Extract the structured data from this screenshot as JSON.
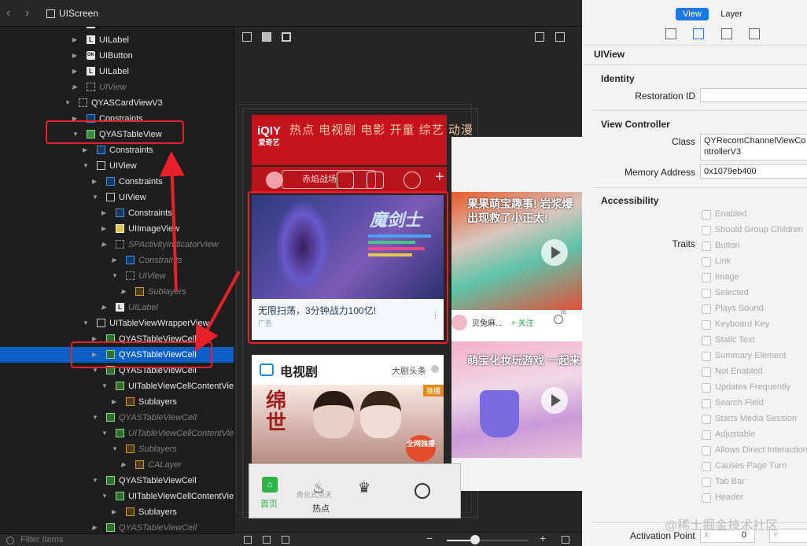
{
  "breadcrumb": {
    "title": "UIScreen"
  },
  "tree": [
    {
      "label": "UIButton",
      "icon": "",
      "dim": true
    },
    {
      "label": "UILabel",
      "icon": "L"
    },
    {
      "label": "UIButton",
      "icon": "OK"
    },
    {
      "label": "UILabel",
      "icon": "L"
    },
    {
      "label": "UIView",
      "icon": "",
      "dim": true
    },
    {
      "label": "QYASCardViewV3",
      "icon": ""
    },
    {
      "label": "Constraints",
      "icon": ""
    },
    {
      "label": "QYASTableView",
      "icon": ""
    },
    {
      "label": "Constraints",
      "icon": ""
    },
    {
      "label": "UIView",
      "icon": ""
    },
    {
      "label": "Constraints",
      "icon": ""
    },
    {
      "label": "UIView",
      "icon": ""
    },
    {
      "label": "Constraints",
      "icon": ""
    },
    {
      "label": "UIImageView",
      "icon": ""
    },
    {
      "label": "SPActivityIndicatorView",
      "icon": "",
      "dim": true
    },
    {
      "label": "Constraints",
      "icon": "",
      "dim": true
    },
    {
      "label": "UIView",
      "icon": "",
      "dim": true
    },
    {
      "label": "Sublayers",
      "icon": "",
      "dim": true
    },
    {
      "label": "UILabel",
      "icon": "L",
      "dim": true
    },
    {
      "label": "UITableViewWrapperView",
      "icon": ""
    },
    {
      "label": "QYASTableViewCell",
      "icon": ""
    },
    {
      "label": "QYASTableViewCell",
      "icon": ""
    },
    {
      "label": "QYASTableViewCell",
      "icon": ""
    },
    {
      "label": "UITableViewCellContentView",
      "icon": ""
    },
    {
      "label": "Sublayers",
      "icon": ""
    },
    {
      "label": "QYASTableViewCell",
      "icon": "",
      "dim": true
    },
    {
      "label": "UITableViewCellContentView",
      "icon": "",
      "dim": true
    },
    {
      "label": "Sublayers",
      "icon": "",
      "dim": true
    },
    {
      "label": "CALayer",
      "icon": "",
      "dim": true
    },
    {
      "label": "QYASTableViewCell",
      "icon": ""
    },
    {
      "label": "UITableViewCellContentView",
      "icon": ""
    },
    {
      "label": "Sublayers",
      "icon": ""
    },
    {
      "label": "QYASTableViewCell",
      "icon": "",
      "dim": true
    }
  ],
  "filter": {
    "placeholder": "Filter Items"
  },
  "app": {
    "logo": "爱奇艺",
    "tabs": "热点  电视剧  电影  开童  综艺  动漫",
    "search_text": "赤焰战场",
    "card_title": "无限扫荡，3分钟战力100亿!",
    "card_sub": "广告",
    "card_dots": "⋮",
    "game_title": "魔剑士",
    "section_title": "电视剧",
    "section_right": "大剧头条",
    "poster_text": "绵世",
    "poster_badge": "独播",
    "poster_badge2": "全网独播",
    "video1_title": "果果萌宝趣事! 岩浆爆出现救了小正太!",
    "video1_author": "贝兔麻...",
    "video1_follow": "+ 关注",
    "video1_count": "16",
    "video2_title": "萌宝化妆玩游戏 一起来",
    "tab1": "首页",
    "tab2": "热点",
    "tab_faint": "奇化式点天"
  },
  "inspector": {
    "tab_view": "View",
    "tab_layer": "Layer",
    "object_type": "UIView",
    "identity_heading": "Identity",
    "restoration_id_label": "Restoration ID",
    "restoration_id_value": "",
    "vc_heading": "View Controller",
    "class_label": "Class",
    "class_value": "QYRecomChannelViewControllerV3",
    "memory_label": "Memory Address",
    "memory_value": "0x1079eb400",
    "accessibility_heading": "Accessibility",
    "traits_label": "Traits",
    "traits": [
      "Enabled",
      "Should Group Children",
      "Button",
      "Link",
      "Image",
      "Selected",
      "Plays Sound",
      "Keyboard Key",
      "Static Text",
      "Summary Element",
      "Not Enabled",
      "Updates Frequently",
      "Search Field",
      "Starts Media Session",
      "Adjustable",
      "Allows Direct Interaction",
      "Causes Page Turn",
      "Tab Bar",
      "Header"
    ],
    "activation_label": "Activation Point",
    "activation_x_label": "X",
    "activation_x_value": "0",
    "activation_y_label": "Y"
  },
  "watermark": "@稀土掘金技术社区",
  "colors": {
    "selection": "#0a60c4",
    "annotation": "#e8202a",
    "accent": "#1a7ae8"
  }
}
